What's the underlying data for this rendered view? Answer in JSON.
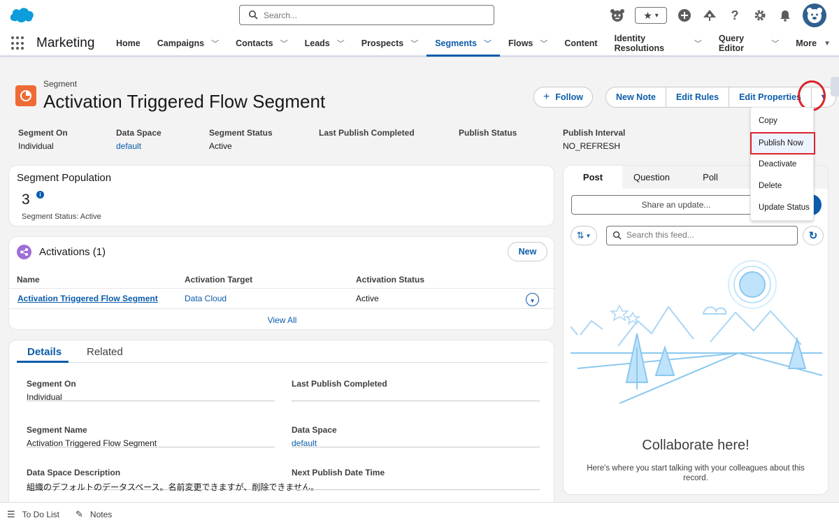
{
  "header": {
    "search_placeholder": "Search...",
    "icons": [
      "astro-icon",
      "favorites-star-icon",
      "favorites-dropdown-icon",
      "add-icon",
      "trailhead-icon",
      "help-icon",
      "setup-gear-icon",
      "notifications-bell-icon",
      "user-avatar"
    ]
  },
  "nav": {
    "app_name": "Marketing",
    "items": [
      {
        "label": "Home",
        "has_menu": false
      },
      {
        "label": "Campaigns",
        "has_menu": true
      },
      {
        "label": "Contacts",
        "has_menu": true
      },
      {
        "label": "Leads",
        "has_menu": true
      },
      {
        "label": "Prospects",
        "has_menu": true
      },
      {
        "label": "Segments",
        "has_menu": true,
        "active": true
      },
      {
        "label": "Flows",
        "has_menu": true
      },
      {
        "label": "Content",
        "has_menu": false
      },
      {
        "label": "Identity Resolutions",
        "has_menu": true
      },
      {
        "label": "Query Editor",
        "has_menu": true
      },
      {
        "label": "More",
        "has_menu": true
      }
    ]
  },
  "record": {
    "type_label": "Segment",
    "title": "Activation Triggered Flow Segment",
    "follow_label": "Follow",
    "actions": [
      "New Note",
      "Edit Rules",
      "Edit Properties"
    ],
    "highlight_fields": [
      {
        "label": "Segment On",
        "value": "Individual",
        "link": false
      },
      {
        "label": "Data Space",
        "value": "default",
        "link": true
      },
      {
        "label": "Segment Status",
        "value": "Active",
        "link": false
      },
      {
        "label": "Last Publish Completed",
        "value": "",
        "link": false
      },
      {
        "label": "Publish Status",
        "value": "",
        "link": false
      },
      {
        "label": "Publish Interval",
        "value": "NO_REFRESH",
        "link": false
      }
    ]
  },
  "menu": {
    "items": [
      "Copy",
      "Publish Now",
      "Deactivate",
      "Delete",
      "Update Status"
    ],
    "highlighted": "Publish Now"
  },
  "population": {
    "title": "Segment Population",
    "count": "3",
    "info_glyph": "i",
    "status_label": "Segment Status:",
    "status_value": "Active"
  },
  "activations": {
    "title": "Activations (1)",
    "new_label": "New",
    "columns": [
      "Name",
      "Activation Target",
      "Activation Status"
    ],
    "rows": [
      {
        "name": "Activation Triggered Flow Segment",
        "target": "Data Cloud",
        "status": "Active"
      }
    ],
    "view_all": "View All"
  },
  "details": {
    "tabs": [
      "Details",
      "Related"
    ],
    "fields": [
      {
        "label": "Segment On",
        "value": "Individual",
        "link": false
      },
      {
        "label": "Last Publish Completed",
        "value": "",
        "link": false
      },
      {
        "label": "Segment Name",
        "value": "Activation Triggered Flow Segment",
        "link": false
      },
      {
        "label": "Data Space",
        "value": "default",
        "link": true
      },
      {
        "label": "Data Space Description",
        "value": "組織のデフォルトのデータスペース。名前変更できますが、削除できません。",
        "link": false
      },
      {
        "label": "Next Publish Date Time",
        "value": "",
        "link": false
      }
    ]
  },
  "feed": {
    "tabs": [
      "Post",
      "Question",
      "Poll"
    ],
    "share_placeholder": "Share an update...",
    "search_placeholder": "Search this feed...",
    "collab_title": "Collaborate here!",
    "collab_text": "Here's where you start talking with your colleagues about this record."
  },
  "utility": {
    "items": [
      "To Do List",
      "Notes"
    ]
  },
  "colors": {
    "brand": "#0b5cab",
    "segment_icon": "#ef6a35",
    "activation_icon": "#9f6ed6",
    "highlight_red": "#d9232d"
  }
}
